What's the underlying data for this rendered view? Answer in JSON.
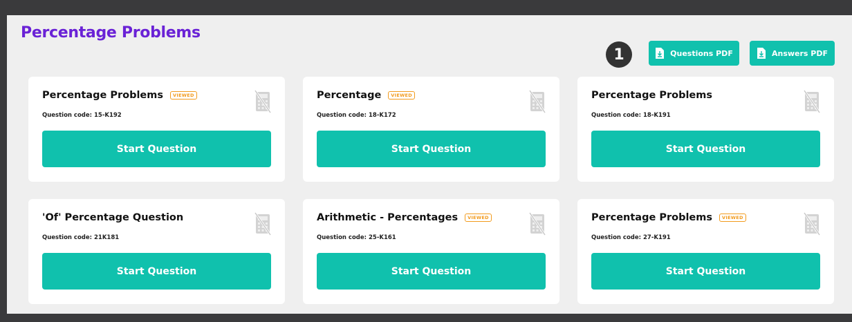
{
  "header": {
    "title": "Percentage Problems",
    "step_number": "1",
    "questions_pdf_label": "Questions PDF",
    "answers_pdf_label": "Answers PDF"
  },
  "cards": [
    {
      "title": "Percentage Problems",
      "viewed": "VIEWED",
      "code": "Question code: 15-K192",
      "button": "Start Question"
    },
    {
      "title": "Percentage",
      "viewed": "VIEWED",
      "code": "Question code: 18-K172",
      "button": "Start Question"
    },
    {
      "title": "Percentage Problems",
      "viewed": "",
      "code": "Question code: 18-K191",
      "button": "Start Question"
    },
    {
      "title": "'Of' Percentage Question",
      "viewed": "",
      "code": "Question code: 21K181",
      "button": "Start Question"
    },
    {
      "title": "Arithmetic - Percentages",
      "viewed": "VIEWED",
      "code": "Question code: 25-K161",
      "button": "Start Question"
    },
    {
      "title": "Percentage Problems",
      "viewed": "VIEWED",
      "code": "Question code: 27-K191",
      "button": "Start Question"
    }
  ],
  "icons": {
    "download": "download-icon",
    "calculator": "no-calculator-icon"
  },
  "colors": {
    "accent": "#10c1ad",
    "title": "#6a22d6",
    "viewed": "#f29a1b"
  }
}
